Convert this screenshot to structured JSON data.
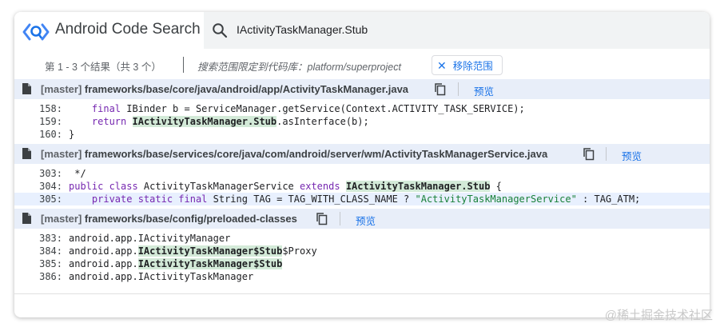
{
  "app": {
    "title": "Android Code Search"
  },
  "search": {
    "query": "IActivityTaskManager.Stub"
  },
  "results": {
    "count_text": "第 1 - 3 个结果（共 3 个）",
    "scope_text": "搜索范围限定到代码库：platform/superproject",
    "clear_label": "移除范围"
  },
  "files": [
    {
      "branch": "[master]",
      "path": "frameworks/base/core/java/android/app/ActivityTaskManager.java",
      "preview": "预览",
      "lines": [
        {
          "num": "158:",
          "segments": [
            {
              "t": "    ",
              "c": ""
            },
            {
              "t": "final",
              "c": "kw"
            },
            {
              "t": " IBinder b = ServiceManager.getService(Context.ACTIVITY_TASK_SERVICE);",
              "c": ""
            }
          ]
        },
        {
          "num": "159:",
          "segments": [
            {
              "t": "    ",
              "c": ""
            },
            {
              "t": "return",
              "c": "kw"
            },
            {
              "t": " ",
              "c": ""
            },
            {
              "t": "IActivityTaskManager.Stub",
              "c": "match"
            },
            {
              "t": ".asInterface(b);",
              "c": ""
            }
          ]
        },
        {
          "num": "160:",
          "segments": [
            {
              "t": "}",
              "c": ""
            }
          ]
        }
      ]
    },
    {
      "branch": "[master]",
      "path": "frameworks/base/services/core/java/com/android/server/wm/ActivityTaskManagerService.java",
      "preview": "预览",
      "lines": [
        {
          "num": "303:",
          "segments": [
            {
              "t": " */",
              "c": ""
            }
          ]
        },
        {
          "num": "304:",
          "segments": [
            {
              "t": "public class",
              "c": "kw"
            },
            {
              "t": " ActivityTaskManagerService ",
              "c": ""
            },
            {
              "t": "extends",
              "c": "kw"
            },
            {
              "t": " ",
              "c": ""
            },
            {
              "t": "IActivityTaskManager.Stub",
              "c": "match"
            },
            {
              "t": " {",
              "c": ""
            }
          ]
        },
        {
          "num": "305:",
          "hl": true,
          "segments": [
            {
              "t": "    ",
              "c": ""
            },
            {
              "t": "private static final",
              "c": "kw"
            },
            {
              "t": " String TAG = TAG_WITH_CLASS_NAME ? ",
              "c": ""
            },
            {
              "t": "\"ActivityTaskManagerService\"",
              "c": "str"
            },
            {
              "t": " : TAG_ATM;",
              "c": ""
            }
          ]
        }
      ]
    },
    {
      "branch": "[master]",
      "path": "frameworks/base/config/preloaded-classes",
      "preview": "预览",
      "lines": [
        {
          "num": "383:",
          "segments": [
            {
              "t": "android.app.IActivityManager",
              "c": ""
            }
          ]
        },
        {
          "num": "384:",
          "segments": [
            {
              "t": "android.app.",
              "c": ""
            },
            {
              "t": "IActivityTaskManager$Stub",
              "c": "match"
            },
            {
              "t": "$Proxy",
              "c": ""
            }
          ]
        },
        {
          "num": "385:",
          "segments": [
            {
              "t": "android.app.",
              "c": ""
            },
            {
              "t": "IActivityTaskManager$Stub",
              "c": "match"
            }
          ]
        },
        {
          "num": "386:",
          "segments": [
            {
              "t": "android.app.IActivityTaskManager",
              "c": ""
            }
          ]
        }
      ]
    }
  ],
  "watermark": "@稀土掘金技术社区",
  "icons": {
    "logo": "code-search-logo-icon",
    "search": "search-icon",
    "file": "file-icon",
    "copy": "copy-icon",
    "close": "close-icon"
  },
  "colors": {
    "accent": "#1a73e8",
    "header_bg": "#e8eef9",
    "match_bg": "#d3ead8",
    "keyword": "#7627b0",
    "string": "#188038"
  }
}
